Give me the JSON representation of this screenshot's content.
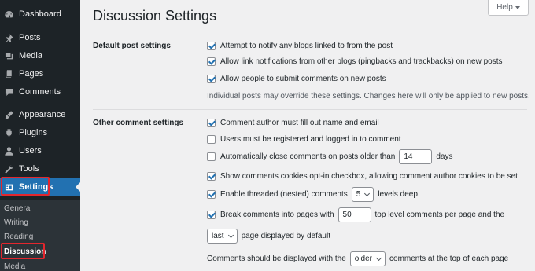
{
  "sidebar": {
    "items": [
      {
        "label": "Dashboard",
        "icon": "dashboard-icon"
      },
      {
        "label": "Posts",
        "icon": "pin-icon"
      },
      {
        "label": "Media",
        "icon": "media-icon"
      },
      {
        "label": "Pages",
        "icon": "pages-icon"
      },
      {
        "label": "Comments",
        "icon": "comments-icon"
      },
      {
        "label": "Appearance",
        "icon": "brush-icon"
      },
      {
        "label": "Plugins",
        "icon": "plugin-icon"
      },
      {
        "label": "Users",
        "icon": "users-icon"
      },
      {
        "label": "Tools",
        "icon": "wrench-icon"
      },
      {
        "label": "Settings",
        "icon": "settings-icon"
      }
    ],
    "submenu": [
      "General",
      "Writing",
      "Reading",
      "Discussion",
      "Media"
    ]
  },
  "header": {
    "title": "Discussion Settings",
    "help_label": "Help"
  },
  "default_post": {
    "label": "Default post settings",
    "options": [
      {
        "label": "Attempt to notify any blogs linked to from the post",
        "checked": true
      },
      {
        "label": "Allow link notifications from other blogs (pingbacks and trackbacks) on new posts",
        "checked": true
      },
      {
        "label": "Allow people to submit comments on new posts",
        "checked": true
      }
    ],
    "description": "Individual posts may override these settings. Changes here will only be applied to new posts."
  },
  "other_comment": {
    "label": "Other comment settings",
    "author_info": {
      "label": "Comment author must fill out name and email",
      "checked": true
    },
    "registered": {
      "label": "Users must be registered and logged in to comment",
      "checked": false
    },
    "auto_close": {
      "label_before": "Automatically close comments on posts older than",
      "value": "14",
      "label_after": "days",
      "checked": false
    },
    "cookies": {
      "label": "Show comments cookies opt-in checkbox, allowing comment author cookies to be set",
      "checked": true
    },
    "threaded": {
      "label_before": "Enable threaded (nested) comments",
      "value": "5",
      "label_after": "levels deep",
      "checked": true
    },
    "paged": {
      "label_before": "Break comments into pages with",
      "value": "50",
      "label_after": "top level comments per page and the",
      "checked": true
    },
    "page_default": {
      "value": "last",
      "label_after": "page displayed by default"
    },
    "order": {
      "label_before": "Comments should be displayed with the",
      "value": "older",
      "label_after": "comments at the top of each page"
    }
  },
  "colors": {
    "accent": "#2271b1",
    "sidebar": "#1d2327",
    "highlight": "#e3262d"
  }
}
